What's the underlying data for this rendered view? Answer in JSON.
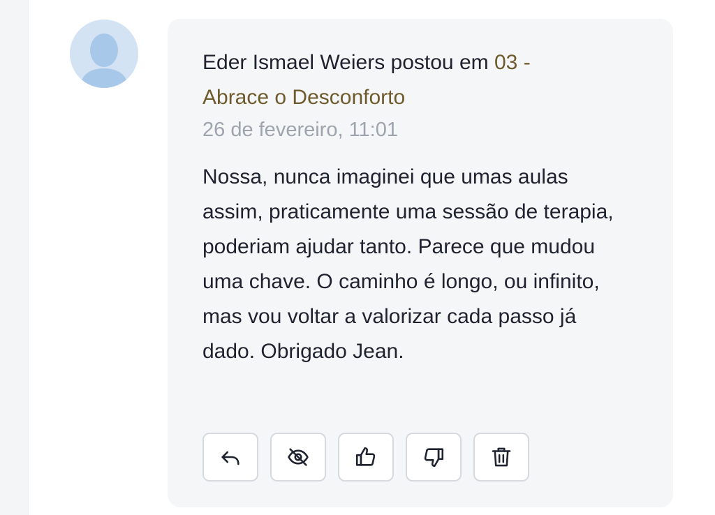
{
  "post": {
    "author": "Eder Ismael Weiers",
    "posted_in": "postou em",
    "topic": "03 - Abrace o Desconforto",
    "timestamp": "26 de fevereiro, 11:01",
    "body": "Nossa, nunca imaginei que umas aulas assim, praticamente uma sessão de terapia, poderiam ajudar tanto. Parece que mudou uma chave. O caminho é longo, ou infinito, mas vou voltar a valorizar cada passo já dado. Obrigado Jean."
  },
  "actions": [
    {
      "icon": "reply-icon"
    },
    {
      "icon": "eye-off-icon"
    },
    {
      "icon": "thumbs-up-icon"
    },
    {
      "icon": "thumbs-down-icon"
    },
    {
      "icon": "trash-icon"
    }
  ],
  "colors": {
    "link": "#6e5a2c",
    "text": "#1f2330",
    "muted": "#9ea4ae",
    "card_bg": "#f5f6f8",
    "avatar_bg": "#dbe6f2"
  }
}
